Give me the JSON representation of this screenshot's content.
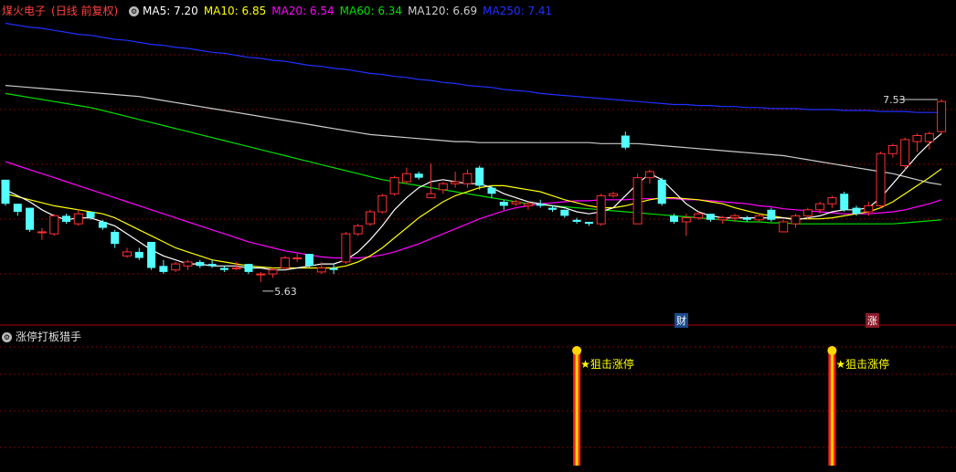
{
  "header": {
    "stock_name": "煤火电子",
    "adjust_label": "(日线 前复权)",
    "ma": [
      {
        "label": "MA5: 7.20",
        "color": "#ffffff"
      },
      {
        "label": "MA10: 6.85",
        "color": "#ffff00"
      },
      {
        "label": "MA20: 6.54",
        "color": "#ff00ff"
      },
      {
        "label": "MA60: 6.34",
        "color": "#00e000"
      },
      {
        "label": "MA120: 6.69",
        "color": "#cccccc"
      },
      {
        "label": "MA250: 7.41",
        "color": "#2030ff"
      }
    ]
  },
  "sub_header": {
    "indicator_name": "涨停打板猎手"
  },
  "annotations": {
    "high_label": "7.53",
    "low_label": "5.63",
    "cai_label": "财",
    "zhang_label": "涨",
    "signal_label": "狙击涨停"
  },
  "colors": {
    "up": "#ff3030",
    "down": "#54ffff",
    "grid": "#800000",
    "signal": "#ffff00"
  },
  "chart_data": [
    {
      "type": "candlestick",
      "title": "煤火电子 (日线 前复权)",
      "ylim": [
        5.3,
        8.35
      ],
      "candles": [
        [
          6.74,
          6.74,
          6.48,
          6.5
        ],
        [
          6.5,
          6.5,
          6.38,
          6.42
        ],
        [
          6.46,
          6.46,
          6.22,
          6.24
        ],
        [
          6.22,
          6.26,
          6.14,
          6.22
        ],
        [
          6.2,
          6.4,
          6.18,
          6.38
        ],
        [
          6.38,
          6.4,
          6.3,
          6.32
        ],
        [
          6.3,
          6.44,
          6.28,
          6.4
        ],
        [
          6.42,
          6.42,
          6.34,
          6.36
        ],
        [
          6.32,
          6.34,
          6.24,
          6.26
        ],
        [
          6.22,
          6.24,
          6.06,
          6.1
        ],
        [
          5.98,
          6.06,
          5.96,
          6.02
        ],
        [
          6.02,
          6.06,
          5.94,
          5.96
        ],
        [
          6.12,
          6.12,
          5.84,
          5.86
        ],
        [
          5.88,
          5.94,
          5.8,
          5.82
        ],
        [
          5.84,
          5.92,
          5.82,
          5.9
        ],
        [
          5.88,
          5.94,
          5.84,
          5.92
        ],
        [
          5.92,
          5.94,
          5.86,
          5.88
        ],
        [
          5.9,
          5.94,
          5.86,
          5.88
        ],
        [
          5.86,
          5.88,
          5.82,
          5.84
        ],
        [
          5.86,
          5.92,
          5.84,
          5.86
        ],
        [
          5.9,
          5.9,
          5.8,
          5.82
        ],
        [
          5.8,
          5.82,
          5.72,
          5.8
        ],
        [
          5.8,
          5.86,
          5.76,
          5.84
        ],
        [
          5.86,
          5.98,
          5.86,
          5.96
        ],
        [
          5.96,
          6.0,
          5.92,
          5.96
        ],
        [
          6.0,
          6.0,
          5.86,
          5.88
        ],
        [
          5.82,
          5.92,
          5.8,
          5.86
        ],
        [
          5.86,
          5.9,
          5.8,
          5.84
        ],
        [
          5.92,
          6.22,
          5.9,
          6.2
        ],
        [
          6.2,
          6.3,
          6.18,
          6.28
        ],
        [
          6.3,
          6.44,
          6.28,
          6.42
        ],
        [
          6.42,
          6.6,
          6.4,
          6.58
        ],
        [
          6.6,
          6.78,
          6.58,
          6.76
        ],
        [
          6.72,
          6.86,
          6.7,
          6.8
        ],
        [
          6.8,
          6.82,
          6.74,
          6.76
        ],
        [
          6.56,
          6.9,
          6.56,
          6.6
        ],
        [
          6.64,
          6.72,
          6.6,
          6.7
        ],
        [
          6.7,
          6.82,
          6.66,
          6.72
        ],
        [
          6.7,
          6.84,
          6.66,
          6.8
        ],
        [
          6.86,
          6.88,
          6.64,
          6.68
        ],
        [
          6.66,
          6.68,
          6.56,
          6.6
        ],
        [
          6.52,
          6.54,
          6.44,
          6.48
        ],
        [
          6.5,
          6.54,
          6.48,
          6.52
        ],
        [
          6.48,
          6.52,
          6.44,
          6.5
        ],
        [
          6.5,
          6.54,
          6.46,
          6.48
        ],
        [
          6.46,
          6.48,
          6.42,
          6.44
        ],
        [
          6.44,
          6.44,
          6.36,
          6.38
        ],
        [
          6.34,
          6.36,
          6.3,
          6.32
        ],
        [
          6.32,
          6.32,
          6.28,
          6.3
        ],
        [
          6.3,
          6.6,
          6.28,
          6.58
        ],
        [
          6.58,
          6.62,
          6.56,
          6.6
        ],
        [
          7.18,
          7.22,
          7.04,
          7.06
        ],
        [
          6.3,
          6.8,
          6.3,
          6.76
        ],
        [
          6.76,
          6.84,
          6.7,
          6.82
        ],
        [
          6.74,
          6.76,
          6.48,
          6.5
        ],
        [
          6.38,
          6.4,
          6.3,
          6.32
        ],
        [
          6.32,
          6.4,
          6.18,
          6.36
        ],
        [
          6.36,
          6.42,
          6.34,
          6.4
        ],
        [
          6.4,
          6.4,
          6.32,
          6.34
        ],
        [
          6.34,
          6.38,
          6.3,
          6.36
        ],
        [
          6.36,
          6.4,
          6.32,
          6.38
        ],
        [
          6.36,
          6.38,
          6.32,
          6.34
        ],
        [
          6.34,
          6.4,
          6.32,
          6.38
        ],
        [
          6.44,
          6.46,
          6.32,
          6.34
        ],
        [
          6.22,
          6.34,
          6.22,
          6.32
        ],
        [
          6.3,
          6.4,
          6.26,
          6.38
        ],
        [
          6.38,
          6.46,
          6.34,
          6.44
        ],
        [
          6.44,
          6.52,
          6.4,
          6.5
        ],
        [
          6.5,
          6.58,
          6.46,
          6.56
        ],
        [
          6.6,
          6.62,
          6.42,
          6.44
        ],
        [
          6.46,
          6.48,
          6.38,
          6.4
        ],
        [
          6.42,
          6.52,
          6.38,
          6.48
        ],
        [
          6.48,
          7.02,
          6.46,
          7.0
        ],
        [
          7.0,
          7.1,
          6.96,
          7.08
        ],
        [
          6.88,
          7.16,
          6.84,
          7.14
        ],
        [
          7.12,
          7.2,
          7.02,
          7.18
        ],
        [
          7.12,
          7.22,
          7.04,
          7.2
        ],
        [
          7.22,
          7.54,
          7.2,
          7.52
        ]
      ],
      "ma5": [
        6.64,
        6.58,
        6.52,
        6.44,
        6.38,
        6.34,
        6.36,
        6.36,
        6.32,
        6.28,
        6.2,
        6.12,
        6.04,
        5.98,
        5.94,
        5.9,
        5.9,
        5.88,
        5.88,
        5.88,
        5.86,
        5.86,
        5.84,
        5.84,
        5.86,
        5.88,
        5.9,
        5.9,
        5.94,
        6.02,
        6.14,
        6.28,
        6.44,
        6.56,
        6.66,
        6.72,
        6.74,
        6.72,
        6.7,
        6.7,
        6.66,
        6.6,
        6.56,
        6.52,
        6.5,
        6.48,
        6.46,
        6.42,
        6.4,
        6.42,
        6.46,
        6.58,
        6.7,
        6.8,
        6.74,
        6.62,
        6.5,
        6.42,
        6.38,
        6.36,
        6.36,
        6.36,
        6.36,
        6.36,
        6.36,
        6.34,
        6.36,
        6.38,
        6.42,
        6.44,
        6.44,
        6.46,
        6.56,
        6.7,
        6.84,
        6.98,
        7.1,
        7.2
      ],
      "ma10": [
        6.6,
        6.57,
        6.54,
        6.51,
        6.48,
        6.46,
        6.44,
        6.42,
        6.4,
        6.36,
        6.3,
        6.24,
        6.18,
        6.12,
        6.06,
        6.02,
        5.98,
        5.94,
        5.92,
        5.9,
        5.88,
        5.87,
        5.86,
        5.86,
        5.86,
        5.86,
        5.86,
        5.86,
        5.88,
        5.92,
        5.98,
        6.06,
        6.16,
        6.26,
        6.36,
        6.44,
        6.52,
        6.58,
        6.62,
        6.66,
        6.68,
        6.68,
        6.66,
        6.64,
        6.62,
        6.58,
        6.54,
        6.51,
        6.48,
        6.46,
        6.46,
        6.48,
        6.51,
        6.54,
        6.56,
        6.56,
        6.55,
        6.54,
        6.52,
        6.5,
        6.46,
        6.43,
        6.4,
        6.38,
        6.36,
        6.35,
        6.35,
        6.35,
        6.36,
        6.38,
        6.4,
        6.42,
        6.46,
        6.52,
        6.6,
        6.68,
        6.76,
        6.85
      ],
      "ma20": [
        6.92,
        6.88,
        6.84,
        6.8,
        6.76,
        6.72,
        6.68,
        6.64,
        6.6,
        6.56,
        6.52,
        6.48,
        6.44,
        6.4,
        6.36,
        6.32,
        6.28,
        6.24,
        6.2,
        6.16,
        6.12,
        6.09,
        6.06,
        6.03,
        6.01,
        5.99,
        5.97,
        5.96,
        5.96,
        5.96,
        5.97,
        5.99,
        6.02,
        6.06,
        6.1,
        6.15,
        6.2,
        6.25,
        6.3,
        6.35,
        6.39,
        6.43,
        6.46,
        6.48,
        6.5,
        6.51,
        6.52,
        6.53,
        6.53,
        6.54,
        6.54,
        6.54,
        6.55,
        6.55,
        6.55,
        6.55,
        6.54,
        6.54,
        6.53,
        6.52,
        6.51,
        6.5,
        6.48,
        6.47,
        6.45,
        6.44,
        6.43,
        6.42,
        6.41,
        6.4,
        6.4,
        6.4,
        6.41,
        6.42,
        6.44,
        6.47,
        6.5,
        6.54
      ],
      "ma60": [
        7.6,
        7.58,
        7.56,
        7.54,
        7.52,
        7.5,
        7.48,
        7.46,
        7.43,
        7.4,
        7.37,
        7.34,
        7.31,
        7.28,
        7.25,
        7.22,
        7.19,
        7.16,
        7.13,
        7.1,
        7.07,
        7.04,
        7.01,
        6.98,
        6.95,
        6.92,
        6.89,
        6.86,
        6.83,
        6.8,
        6.77,
        6.74,
        6.72,
        6.7,
        6.68,
        6.66,
        6.64,
        6.62,
        6.6,
        6.58,
        6.56,
        6.54,
        6.52,
        6.5,
        6.49,
        6.48,
        6.47,
        6.46,
        6.45,
        6.44,
        6.43,
        6.42,
        6.41,
        6.4,
        6.39,
        6.38,
        6.37,
        6.36,
        6.35,
        6.34,
        6.33,
        6.32,
        6.32,
        6.31,
        6.31,
        6.3,
        6.3,
        6.3,
        6.3,
        6.3,
        6.3,
        6.3,
        6.3,
        6.3,
        6.31,
        6.32,
        6.33,
        6.34
      ],
      "ma120": [
        7.68,
        7.67,
        7.66,
        7.65,
        7.64,
        7.63,
        7.62,
        7.61,
        7.6,
        7.59,
        7.58,
        7.57,
        7.55,
        7.53,
        7.51,
        7.49,
        7.47,
        7.45,
        7.43,
        7.41,
        7.39,
        7.37,
        7.35,
        7.33,
        7.31,
        7.29,
        7.27,
        7.25,
        7.23,
        7.21,
        7.19,
        7.18,
        7.17,
        7.16,
        7.15,
        7.14,
        7.13,
        7.12,
        7.12,
        7.11,
        7.11,
        7.11,
        7.11,
        7.11,
        7.11,
        7.11,
        7.11,
        7.11,
        7.11,
        7.1,
        7.1,
        7.1,
        7.1,
        7.09,
        7.08,
        7.07,
        7.06,
        7.05,
        7.04,
        7.03,
        7.02,
        7.01,
        7.0,
        6.99,
        6.98,
        6.96,
        6.94,
        6.92,
        6.9,
        6.88,
        6.86,
        6.84,
        6.82,
        6.8,
        6.77,
        6.74,
        6.71,
        6.69
      ],
      "ma250": [
        8.3,
        8.28,
        8.26,
        8.25,
        8.23,
        8.21,
        8.19,
        8.18,
        8.16,
        8.14,
        8.13,
        8.11,
        8.09,
        8.08,
        8.06,
        8.05,
        8.03,
        8.01,
        8.0,
        7.98,
        7.96,
        7.95,
        7.93,
        7.92,
        7.9,
        7.88,
        7.87,
        7.85,
        7.84,
        7.82,
        7.8,
        7.79,
        7.77,
        7.76,
        7.74,
        7.73,
        7.71,
        7.7,
        7.68,
        7.67,
        7.66,
        7.64,
        7.63,
        7.62,
        7.6,
        7.59,
        7.58,
        7.57,
        7.56,
        7.55,
        7.54,
        7.53,
        7.52,
        7.51,
        7.5,
        7.49,
        7.49,
        7.48,
        7.48,
        7.47,
        7.47,
        7.46,
        7.46,
        7.45,
        7.45,
        7.45,
        7.44,
        7.44,
        7.44,
        7.43,
        7.43,
        7.43,
        7.42,
        7.42,
        7.42,
        7.41,
        7.41,
        7.41
      ],
      "signal_index": [
        47,
        68
      ]
    }
  ]
}
